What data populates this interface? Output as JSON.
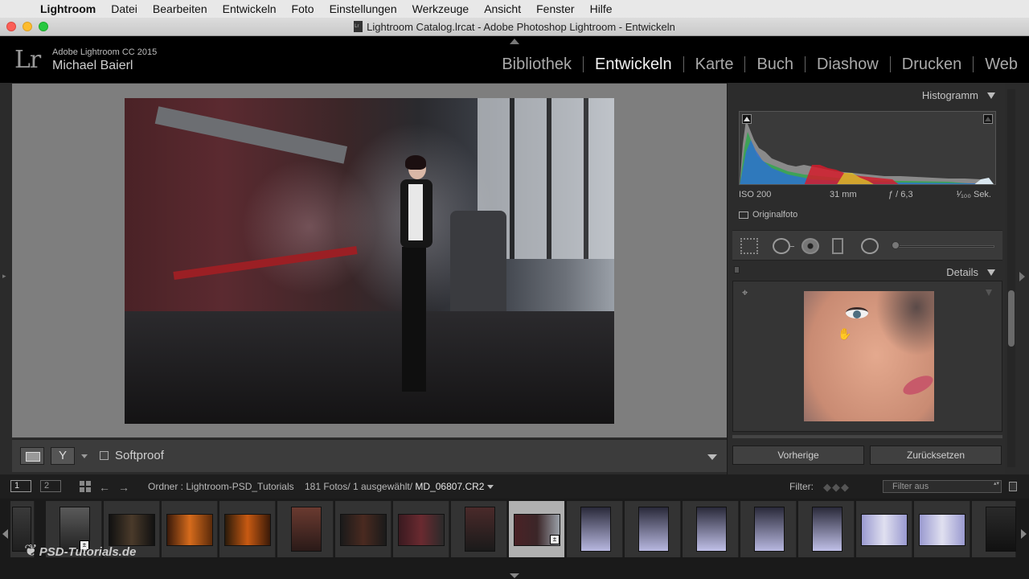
{
  "menubar": {
    "items": [
      "Lightroom",
      "Datei",
      "Bearbeiten",
      "Entwickeln",
      "Foto",
      "Einstellungen",
      "Werkzeuge",
      "Ansicht",
      "Fenster",
      "Hilfe"
    ]
  },
  "window": {
    "title": "Lightroom Catalog.lrcat - Adobe Photoshop Lightroom - Entwickeln"
  },
  "identity": {
    "logo": "Lr",
    "product": "Adobe Lightroom CC 2015",
    "user": "Michael Baierl"
  },
  "modules": {
    "items": [
      "Bibliothek",
      "Entwickeln",
      "Karte",
      "Buch",
      "Diashow",
      "Drucken",
      "Web"
    ],
    "active": "Entwickeln"
  },
  "toolbar": {
    "softproof_label": "Softproof"
  },
  "histogram": {
    "title": "Histogramm",
    "iso": "ISO 200",
    "focal": "31 mm",
    "aperture": "ƒ / 6,3",
    "shutter": "¹⁄₁₀₀ Sek.",
    "original_label": "Originalfoto"
  },
  "details": {
    "title": "Details"
  },
  "buttons": {
    "previous": "Vorherige",
    "reset": "Zurücksetzen"
  },
  "filmstrip_bar": {
    "monitor1": "1",
    "monitor2": "2",
    "source": "Ordner : Lightroom-PSD_Tutorials",
    "count": "181 Fotos/ 1 ausgewählt/",
    "file": "MD_06807.CR2",
    "filter_label": "Filter:",
    "filter_value": "Filter aus"
  },
  "watermark": {
    "text": "PSD-Tutorials.de"
  },
  "icons": {
    "apple": "apple-icon",
    "crop": "crop-icon",
    "spot": "spot-removal-icon",
    "redeye": "red-eye-icon",
    "graduated": "graduated-filter-icon",
    "radial": "radial-filter-icon",
    "target": "target-icon",
    "hand": "hand-icon",
    "grid": "grid-view-icon"
  },
  "colors": {
    "menubar_bg": "#e8e8e8",
    "panel_bg": "#2c2c2c",
    "canvas_bg": "#7e7e7e",
    "selected_thumb": "#b0b0b0"
  }
}
